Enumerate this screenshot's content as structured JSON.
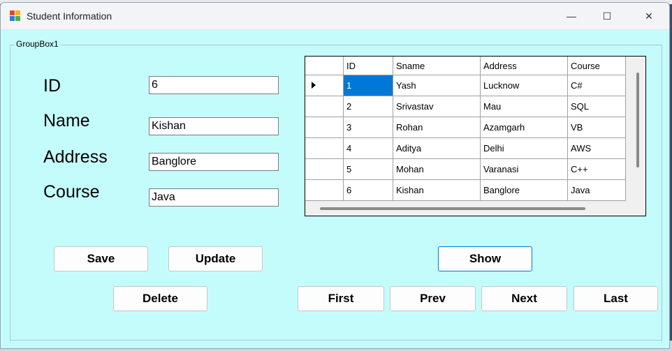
{
  "window": {
    "title": "Student Information",
    "minimize_glyph": "—",
    "maximize_glyph": "☐",
    "close_glyph": "✕"
  },
  "groupbox": {
    "label": "GroupBox1"
  },
  "form": {
    "id_label": "ID",
    "id_value": "6",
    "name_label": "Name",
    "name_value": "Kishan",
    "address_label": "Address",
    "address_value": "Banglore",
    "course_label": "Course",
    "course_value": "Java"
  },
  "grid": {
    "columns": [
      "ID",
      "Sname",
      "Address",
      "Course"
    ],
    "rows": [
      [
        "1",
        "Yash",
        "Lucknow",
        "C#"
      ],
      [
        "2",
        "Srivastav",
        "Mau",
        "SQL"
      ],
      [
        "3",
        "Rohan",
        "Azamgarh",
        "VB"
      ],
      [
        "4",
        "Aditya",
        "Delhi",
        "AWS"
      ],
      [
        "5",
        "Mohan",
        "Varanasi",
        "C++"
      ],
      [
        "6",
        "Kishan",
        "Banglore",
        "Java"
      ]
    ],
    "selected_row": 0,
    "selection_color": "#0078d7"
  },
  "buttons": {
    "save": "Save",
    "update": "Update",
    "show": "Show",
    "delete": "Delete",
    "first": "First",
    "prev": "Prev",
    "next": "Next",
    "last": "Last"
  },
  "colors": {
    "form_background": "#c4fcfc",
    "titlebar": "#f3f4f6"
  }
}
